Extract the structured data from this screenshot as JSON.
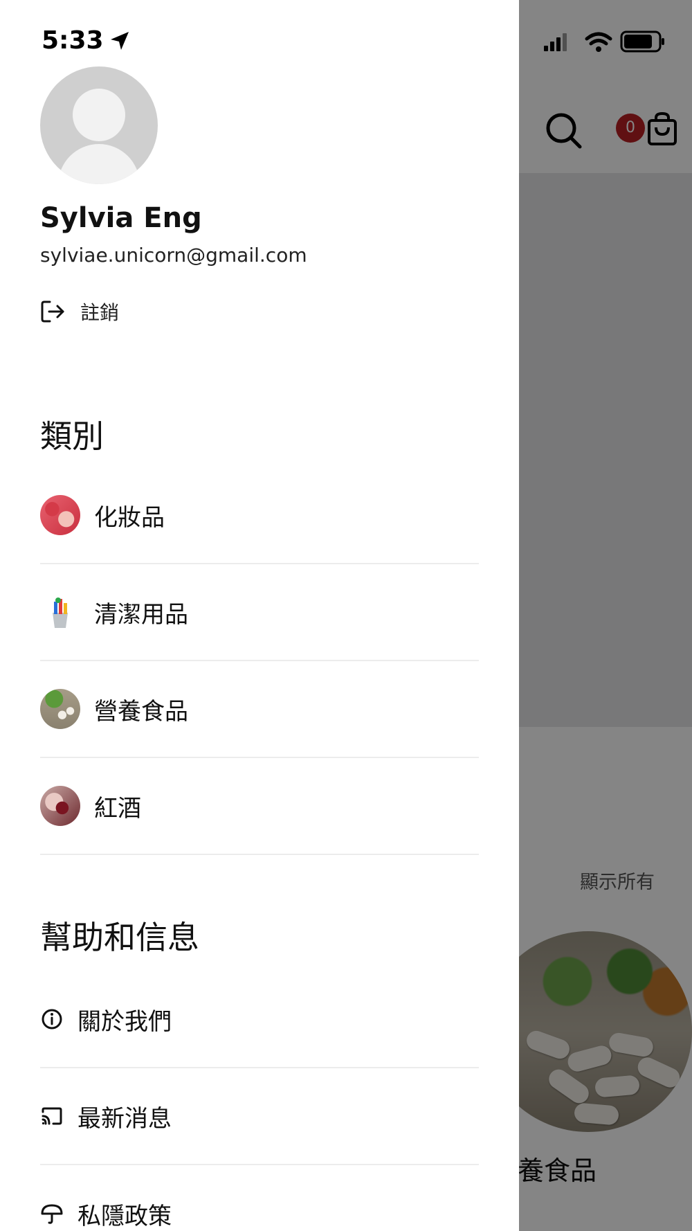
{
  "status_bar": {
    "time": "5:33"
  },
  "profile": {
    "name": "Sylvia Eng",
    "email": "sylviae.unicorn@gmail.com",
    "logout_label": "註銷"
  },
  "categories": {
    "title": "類別",
    "items": [
      {
        "label": "化妝品"
      },
      {
        "label": "清潔用品"
      },
      {
        "label": "營養食品"
      },
      {
        "label": "紅酒"
      }
    ]
  },
  "help": {
    "title": "幫助和信息",
    "items": [
      {
        "label": "關於我們",
        "icon": "info-icon"
      },
      {
        "label": "最新消息",
        "icon": "cast-icon"
      },
      {
        "label": "私隱政策",
        "icon": "umbrella-icon"
      }
    ]
  },
  "background": {
    "cart_count": "0",
    "show_all": "顯示所有",
    "category_label": "養食品"
  },
  "colors": {
    "badge": "#b81f24",
    "overlay": "rgba(0,0,0,0.48)"
  }
}
